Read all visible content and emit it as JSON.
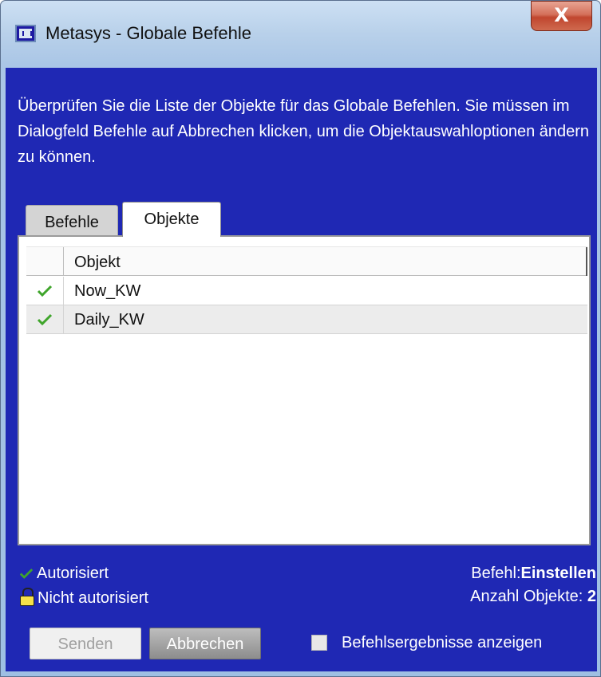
{
  "window": {
    "title": "Metasys - Globale Befehle",
    "close_label": "X"
  },
  "instructions": "Überprüfen Sie die Liste der Objekte für das Globale Befehlen. Sie müssen im Dialogfeld Befehle auf Abbrechen klicken, um die Objektauswahloptionen ändern zu können.",
  "tabs": [
    {
      "label": "Befehle",
      "active": false
    },
    {
      "label": "Objekte",
      "active": true
    }
  ],
  "table": {
    "column_header": "Objekt",
    "rows": [
      {
        "name": "Now_KW",
        "status": "authorized"
      },
      {
        "name": "Daily_KW",
        "status": "authorized"
      }
    ]
  },
  "legend": {
    "authorized": "Autorisiert",
    "not_authorized": "Nicht autorisiert"
  },
  "info": {
    "command_label": "Befehl:",
    "command_value": "Einstellen",
    "count_label": "Anzahl Objekte: ",
    "count_value": "2"
  },
  "buttons": {
    "send": "Senden",
    "cancel": "Abbrechen"
  },
  "show_results": {
    "label": "Befehlsergebnisse anzeigen",
    "checked": false
  },
  "colors": {
    "client_background": "#1f28b4",
    "check_green": "#3fa52b",
    "lock_yellow": "#f5e14a"
  },
  "icons": {
    "app": "metasys-app-icon",
    "close": "close-icon",
    "check": "checkmark-icon",
    "lock": "lock-icon"
  }
}
